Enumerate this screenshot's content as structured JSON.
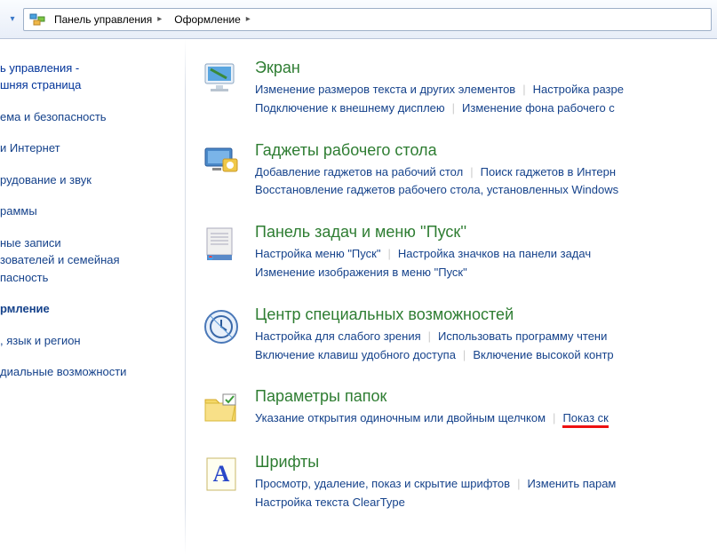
{
  "colors": {
    "heading": "#2e7d32",
    "link": "#15428b"
  },
  "breadcrumb": {
    "root": "Панель управления",
    "current": "Оформление"
  },
  "sidebar": {
    "home1": "ь управления -",
    "home2": "шняя страница",
    "items": [
      "ема и безопасность",
      "и Интернет",
      "рудование и звук",
      "раммы",
      "ные записи",
      "зователей и семейная",
      "пасность",
      "рмление",
      ", язык и регион",
      "диальные возможности"
    ],
    "active_index": 7
  },
  "sections": [
    {
      "title": "Экран",
      "tasks": [
        "Изменение размеров текста и других элементов",
        "Настройка разре",
        "Подключение к внешнему дисплею",
        "Изменение фона рабочего с"
      ]
    },
    {
      "title": "Гаджеты рабочего стола",
      "tasks": [
        "Добавление гаджетов на рабочий стол",
        "Поиск гаджетов в Интерн",
        "Восстановление гаджетов рабочего стола, установленных Windows"
      ]
    },
    {
      "title": "Панель задач и меню ''Пуск''",
      "tasks": [
        "Настройка меню \"Пуск\"",
        "Настройка значков на панели задач",
        "Изменение изображения в меню \"Пуск\""
      ]
    },
    {
      "title": "Центр специальных возможностей",
      "tasks": [
        "Настройка для слабого зрения",
        "Использовать программу чтени",
        "Включение клавиш удобного доступа",
        "Включение высокой контр"
      ]
    },
    {
      "title": "Параметры папок",
      "tasks": [
        "Указание открытия одиночным или двойным щелчком",
        "Показ ск"
      ],
      "highlight": 1
    },
    {
      "title": "Шрифты",
      "tasks": [
        "Просмотр, удаление, показ и скрытие шрифтов",
        "Изменить парам",
        "Настройка текста ClearType"
      ]
    }
  ]
}
